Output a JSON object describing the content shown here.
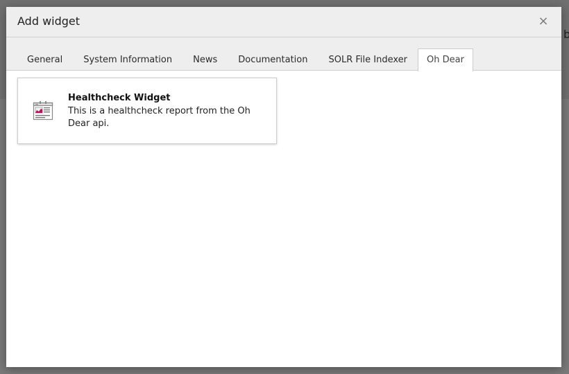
{
  "modal": {
    "title": "Add widget",
    "close_glyph": "×"
  },
  "tabs": [
    {
      "label": "General",
      "active": false
    },
    {
      "label": "System Information",
      "active": false
    },
    {
      "label": "News",
      "active": false
    },
    {
      "label": "Documentation",
      "active": false
    },
    {
      "label": "SOLR File Indexer",
      "active": false
    },
    {
      "label": "Oh Dear",
      "active": true
    }
  ],
  "widget": {
    "title": "Healthcheck Widget",
    "description": "This is a healthcheck report from the Oh Dear api.",
    "icon": "widget-chart-icon"
  },
  "background": {
    "visible_char": "b"
  },
  "colors": {
    "icon_accent": "#b1185a",
    "icon_gray": "#777777"
  }
}
